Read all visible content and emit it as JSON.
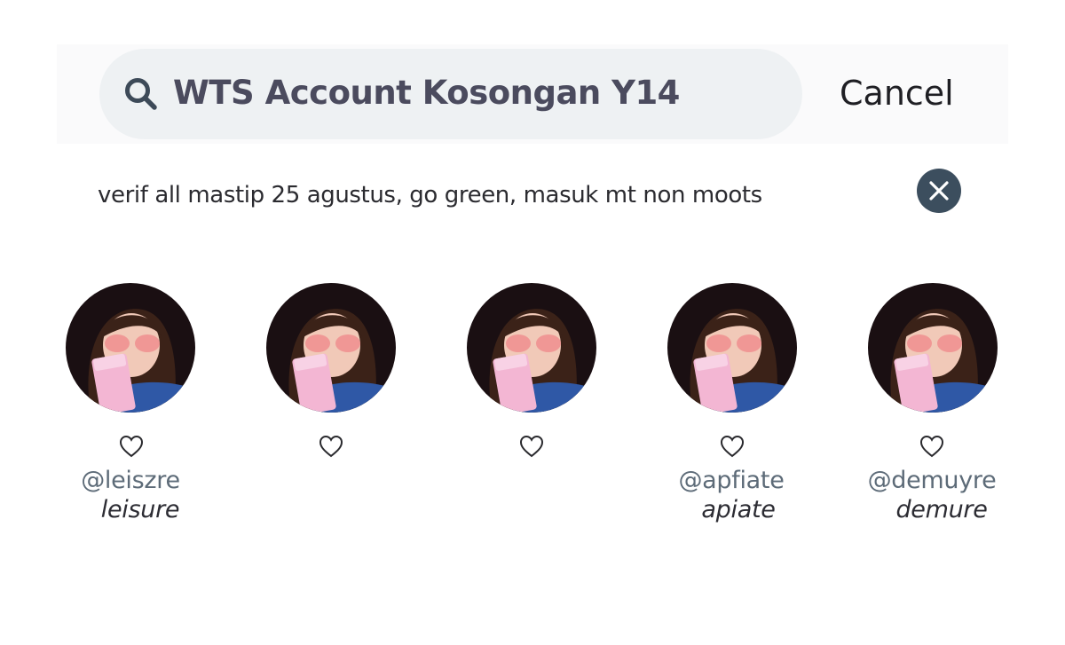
{
  "search": {
    "query": "WTS Account Kosongan Y14",
    "cancel_label": "Cancel"
  },
  "subtitle": "verif all mastip 25 agustus, go green, masuk mt non moots",
  "accounts": [
    {
      "handle": "@leiszre",
      "name": "leisure",
      "heart": "♡"
    },
    {
      "handle": "",
      "name": "",
      "heart": "♡"
    },
    {
      "handle": "",
      "name": "",
      "heart": "♡"
    },
    {
      "handle": "@apfiate",
      "name": "apiate",
      "heart": "♡"
    },
    {
      "handle": "@demuyre",
      "name": "demure",
      "heart": "♡"
    }
  ],
  "icons": {
    "search": "search-icon",
    "clear": "close-icon",
    "like": "heart-icon"
  },
  "colors": {
    "search_bg": "#eef1f3",
    "query_text": "#4b4b5e",
    "clear_button": "#3c4e5e",
    "handle_text": "#5d6b78"
  }
}
